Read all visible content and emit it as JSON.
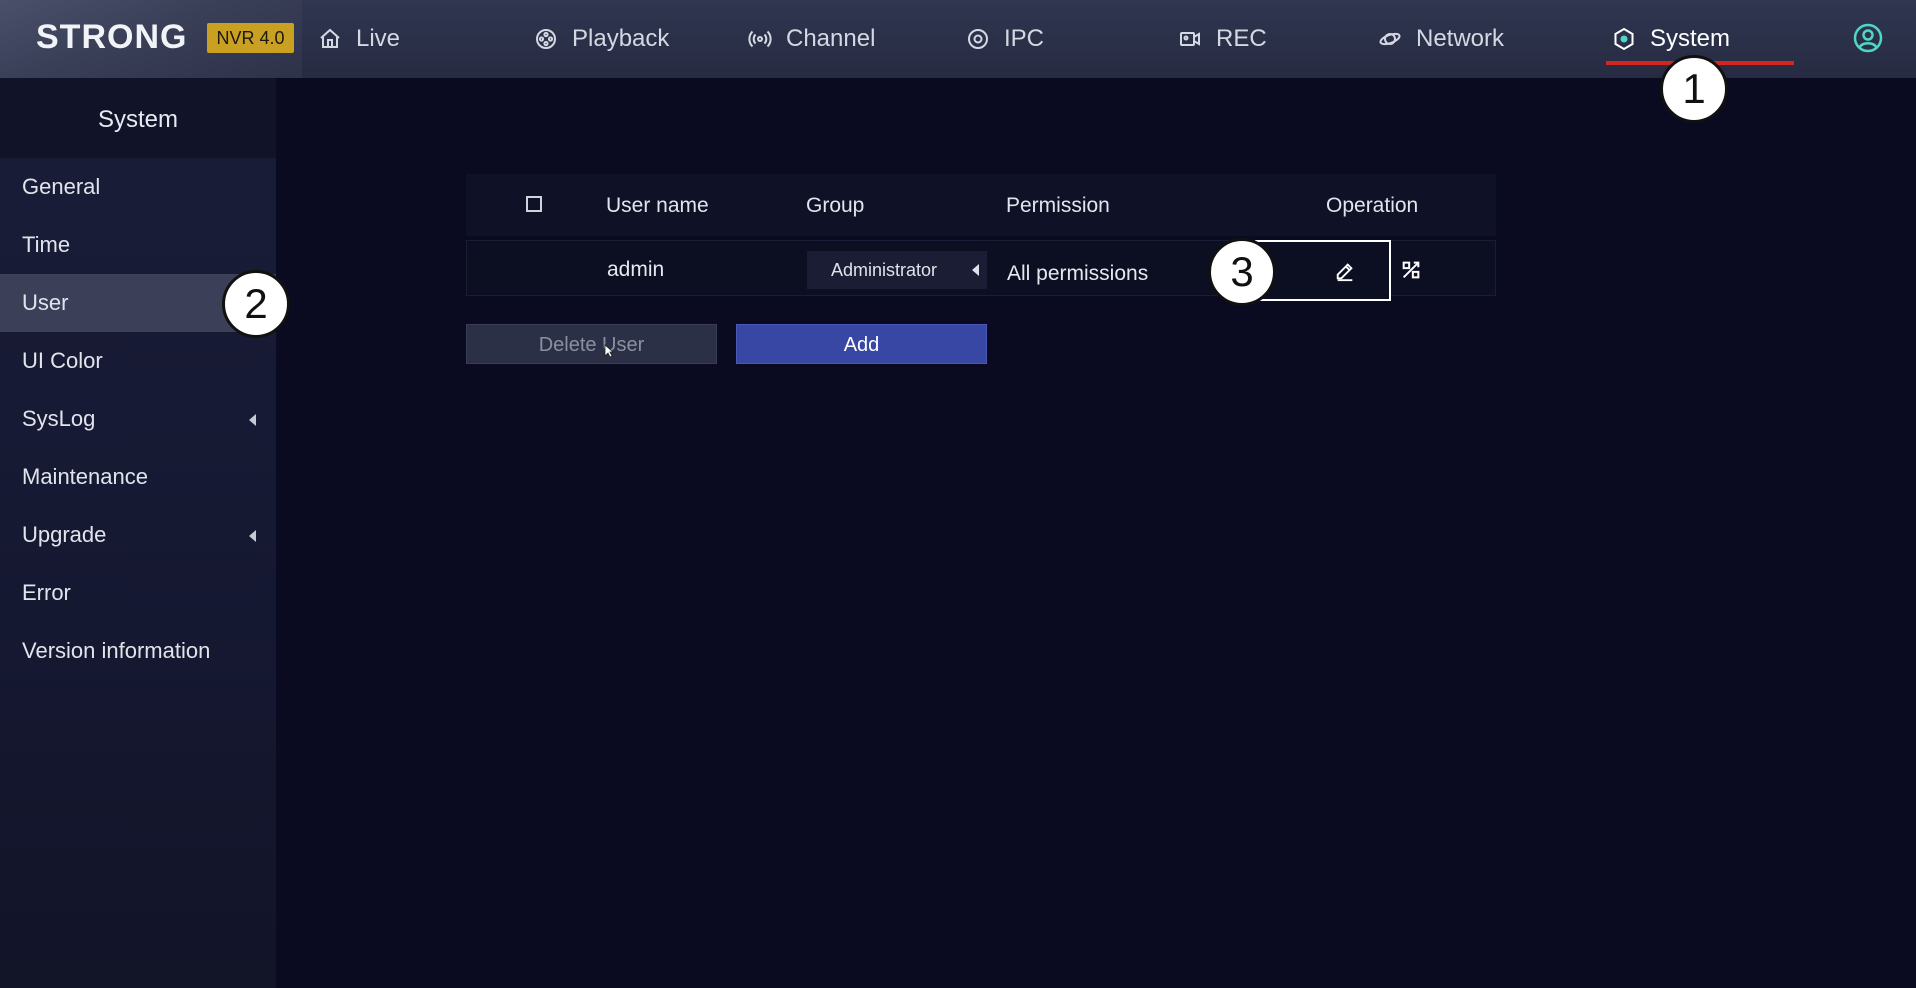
{
  "brand": {
    "logo": "STRONG",
    "badge": "NVR 4.0"
  },
  "nav": {
    "live": "Live",
    "playback": "Playback",
    "channel": "Channel",
    "ipc": "IPC",
    "rec": "REC",
    "network": "Network",
    "system": "System"
  },
  "sidebar": {
    "title": "System",
    "items": [
      {
        "label": "General"
      },
      {
        "label": "Time"
      },
      {
        "label": "User"
      },
      {
        "label": "UI  Color"
      },
      {
        "label": "SysLog"
      },
      {
        "label": "Maintenance"
      },
      {
        "label": "Upgrade"
      },
      {
        "label": "Error"
      },
      {
        "label": "Version  information"
      }
    ]
  },
  "table": {
    "headers": {
      "username": "User  name",
      "group": "Group",
      "permission": "Permission",
      "operation": "Operation"
    },
    "rows": [
      {
        "username": "admin",
        "group": "Administrator",
        "permission": "All  permissions"
      }
    ]
  },
  "buttons": {
    "delete": "Delete  User",
    "add": "Add"
  },
  "callouts": [
    "1",
    "2",
    "3"
  ],
  "colors": {
    "accent_underline": "#d3261e",
    "add_button": "#3947a4",
    "badge": "#c9a022",
    "active_icon": "#4fd6c4"
  }
}
